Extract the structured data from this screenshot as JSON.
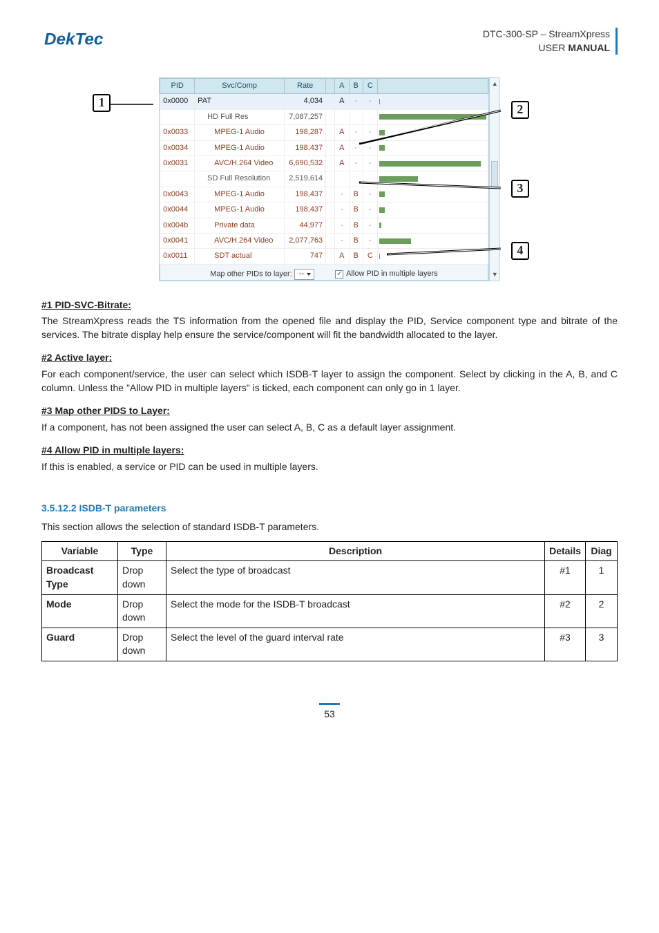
{
  "header": {
    "product": "DTC-300-SP – StreamXpress",
    "subtitle_prefix": "USER ",
    "subtitle_bold": "MANUAL",
    "logo_text": "DekTec"
  },
  "table": {
    "headers": {
      "pid": "PID",
      "svc": "Svc/Comp",
      "rate": "Rate",
      "a": "A",
      "b": "B",
      "c": "C"
    },
    "rows": [
      {
        "pid": "0x0000",
        "svc": "PAT",
        "rate": "4,034",
        "a": "A",
        "b": "-",
        "c": "-",
        "bar_pct": 1,
        "style": "sel"
      },
      {
        "pid": "",
        "svc": "HD Full Res",
        "rate": "7,087,257",
        "a": "",
        "b": "",
        "c": "",
        "bar_pct": 100,
        "style": "grp"
      },
      {
        "pid": "0x0033",
        "svc": "MPEG-1 Audio",
        "rate": "198,287",
        "a": "A",
        "b": "-",
        "c": "-",
        "bar_pct": 5,
        "style": "data"
      },
      {
        "pid": "0x0034",
        "svc": "MPEG-1 Audio",
        "rate": "198,437",
        "a": "A",
        "b": "-",
        "c": "-",
        "bar_pct": 5,
        "style": "data"
      },
      {
        "pid": "0x0031",
        "svc": "AVC/H.264 Video",
        "rate": "6,690,532",
        "a": "A",
        "b": "-",
        "c": "-",
        "bar_pct": 95,
        "style": "data"
      },
      {
        "pid": "",
        "svc": "SD Full Resolution",
        "rate": "2,519,614",
        "a": "",
        "b": "",
        "c": "",
        "bar_pct": 36,
        "style": "grp"
      },
      {
        "pid": "0x0043",
        "svc": "MPEG-1 Audio",
        "rate": "198,437",
        "a": "-",
        "b": "B",
        "c": "-",
        "bar_pct": 5,
        "style": "data"
      },
      {
        "pid": "0x0044",
        "svc": "MPEG-1 Audio",
        "rate": "198,437",
        "a": "-",
        "b": "B",
        "c": "-",
        "bar_pct": 5,
        "style": "data"
      },
      {
        "pid": "0x004b",
        "svc": "Private data",
        "rate": "44,977",
        "a": "-",
        "b": "B",
        "c": "-",
        "bar_pct": 2,
        "style": "data"
      },
      {
        "pid": "0x0041",
        "svc": "AVC/H.264 Video",
        "rate": "2,077,763",
        "a": "-",
        "b": "B",
        "c": "-",
        "bar_pct": 30,
        "style": "data"
      },
      {
        "pid": "0x0011",
        "svc": "SDT actual",
        "rate": "747",
        "a": "A",
        "b": "B",
        "c": "C",
        "bar_pct": 1,
        "style": "data"
      }
    ],
    "map_other_label": "Map other PIDs to layer:",
    "map_other_value": "--",
    "allow_multi_label": "Allow PID in multiple layers"
  },
  "callouts": {
    "c1": "1",
    "c2": "2",
    "c3": "3",
    "c4": "4"
  },
  "sections": {
    "s1_title": "#1 PID-SVC-Bitrate:",
    "s1_body": "The StreamXpress reads the TS information from the opened file and display the PID, Service component type and bitrate of the services. The bitrate display help ensure the service/component will fit the bandwidth allocated to the layer.",
    "s2_title": "#2 Active layer:",
    "s2_body": "For each component/service, the user can select which ISDB-T layer to assign the component. Select by clicking in the A, B, and C column. Unless the \"Allow PID in multiple layers\" is ticked, each component can only go in 1 layer.",
    "s3_title": "#3 Map other PIDS to Layer:",
    "s3_body": "If a component, has not been assigned the user can select A, B, C as a default layer assignment.",
    "s4_title": "#4 Allow PID in multiple layers:",
    "s4_body": "If this is enabled, a service or PID can be used in multiple layers."
  },
  "params": {
    "heading": "3.5.12.2 ISDB-T parameters",
    "intro": "This section allows the selection of standard ISDB-T parameters.",
    "headers": {
      "var": "Variable",
      "type": "Type",
      "desc": "Description",
      "details": "Details",
      "diag": "Diag"
    },
    "rows": [
      {
        "var": "Broadcast Type",
        "type": "Drop down",
        "desc": "Select the type of broadcast",
        "details": "#1",
        "diag": "1"
      },
      {
        "var": "Mode",
        "type": "Drop down",
        "desc": "Select the mode for the ISDB-T broadcast",
        "details": "#2",
        "diag": "2"
      },
      {
        "var": "Guard",
        "type": "Drop down",
        "desc": "Select the level of the guard interval rate",
        "details": "#3",
        "diag": "3"
      }
    ]
  },
  "page_number": "53"
}
